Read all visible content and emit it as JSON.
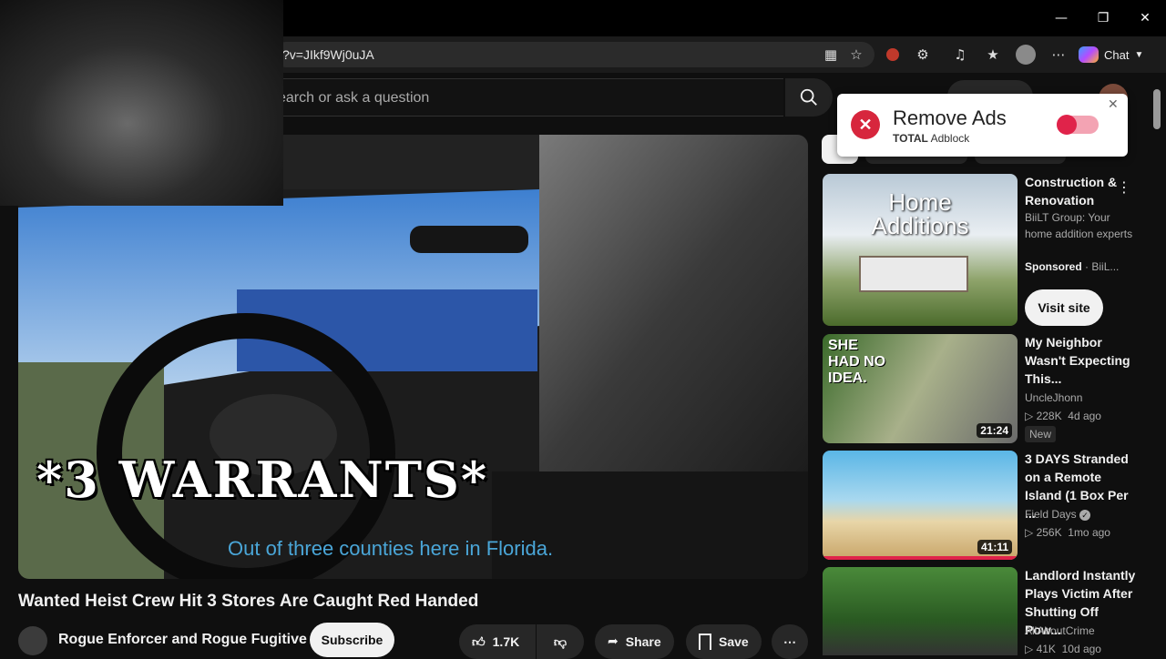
{
  "browser": {
    "url_visible": "?v=JIkf9Wj0uJA",
    "chat_label": "Chat",
    "window_controls": [
      "minimize",
      "restore",
      "close"
    ]
  },
  "youtube_header": {
    "search_placeholder": "earch or ask a question"
  },
  "video": {
    "overlay_text": "*3 WARRANTS*",
    "caption": "Out of three counties here in Florida.",
    "title": "Wanted Heist Crew Hit 3 Stores Are Caught Red Handed",
    "channel": "Rogue Enforcer and Rogue Fugitive",
    "subscribe_label": "Subscribe",
    "likes": "1.7K",
    "share_label": "Share",
    "save_label": "Save"
  },
  "adblock_popup": {
    "title": "Remove Ads",
    "brand_bold": "TOTAL",
    "brand_rest": "Adblock",
    "toggle_on": true,
    "toggle_color": "#e0234a"
  },
  "sidebar": {
    "ad": {
      "thumb_text_1": "Home",
      "thumb_text_2": "Additions",
      "title": "Construction & Renovation",
      "description": "BiiLT Group: Your home addition experts",
      "sponsored_label": "Sponsored",
      "sponsor_name": "BiiL...",
      "cta_label": "Visit site"
    },
    "videos": [
      {
        "thumb_text": "SHE HAD NO IDEA.",
        "title": "My Neighbor Wasn't Expecting This...",
        "channel": "UncleJhonn",
        "views": "228K",
        "age": "4d ago",
        "duration": "21:24",
        "badge": "New"
      },
      {
        "title": "3 DAYS Stranded on a Remote Island (1 Box Per ...",
        "channel": "Field Days",
        "verified": true,
        "views": "256K",
        "age": "1mo ago",
        "duration": "41:11"
      },
      {
        "title": "Landlord Instantly Plays Victim After Shutting Off Pow...",
        "channel": "AllAboutCrime",
        "views": "41K",
        "age": "10d ago"
      }
    ]
  }
}
